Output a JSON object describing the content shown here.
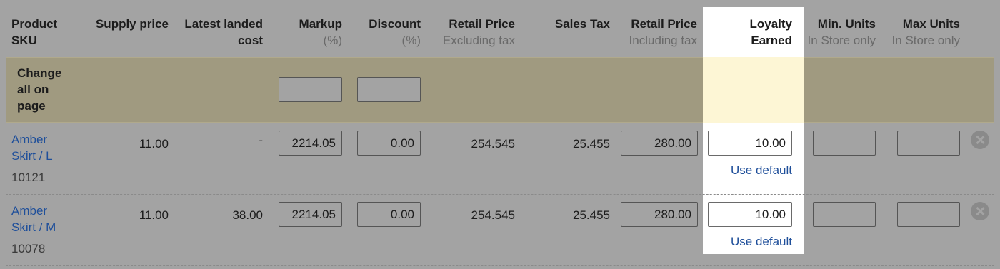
{
  "headers": {
    "product": "Product SKU",
    "product_line1": "Product",
    "product_line2": "SKU",
    "supply_price": "Supply price",
    "landed_line1": "Latest landed",
    "landed_line2": "cost",
    "markup": "Markup",
    "markup_sub": "(%)",
    "discount": "Discount",
    "discount_sub": "(%)",
    "retail_ex": "Retail Price",
    "retail_ex_sub": "Excluding tax",
    "sales_tax": "Sales Tax",
    "retail_inc": "Retail Price",
    "retail_inc_sub": "Including tax",
    "loyalty_line1": "Loyalty",
    "loyalty_line2": "Earned",
    "min_units": "Min. Units",
    "min_units_sub": "In Store only",
    "max_units": "Max Units",
    "max_units_sub": "In Store only"
  },
  "change_all": {
    "label_line1": "Change",
    "label_line2": "all on",
    "label_line3": "page",
    "markup_value": "",
    "discount_value": ""
  },
  "rows": [
    {
      "name_line1": "Amber",
      "name_line2": "Skirt / L",
      "sku": "10121",
      "supply_price": "11.00",
      "landed_cost": "-",
      "markup": "2214.05",
      "discount": "0.00",
      "retail_ex": "254.545",
      "sales_tax": "25.455",
      "retail_inc": "280.00",
      "loyalty": "10.00",
      "use_default": "Use default",
      "min_units": "",
      "max_units": ""
    },
    {
      "name_line1": "Amber",
      "name_line2": "Skirt / M",
      "sku": "10078",
      "supply_price": "11.00",
      "landed_cost": "38.00",
      "markup": "2214.05",
      "discount": "0.00",
      "retail_ex": "254.545",
      "sales_tax": "25.455",
      "retail_inc": "280.00",
      "loyalty": "10.00",
      "use_default": "Use default",
      "min_units": "",
      "max_units": ""
    }
  ],
  "icons": {
    "remove": "close-circle-icon"
  },
  "colors": {
    "highlight": "#ffffff",
    "change_band": "#a09a80",
    "link": "#1f4f9a"
  }
}
